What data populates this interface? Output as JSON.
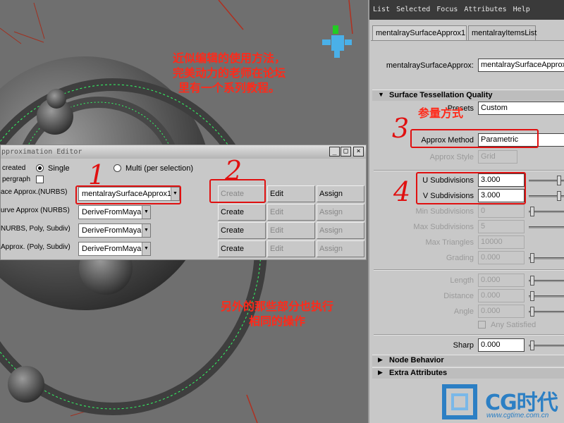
{
  "annotations": {
    "top_note_line1": "近似编辑的使用方法，",
    "top_note_line2": "完美动力的老师在论坛",
    "top_note_line3": "里有一个系列教程。",
    "bottom_note_line1": "另外的那些部分也执行",
    "bottom_note_line2": "相同的操作",
    "approx_method_note": "参量方式",
    "num1": "1",
    "num2": "2",
    "num3": "3",
    "num4": "4"
  },
  "editor": {
    "title": "pproximation Editor",
    "minimize": "_",
    "maximize": "□",
    "close": "×",
    "created_label": "created",
    "single_label": "Single",
    "multi_label": "Multi (per selection)",
    "pergraph_label": "pergraph",
    "rows": [
      {
        "label": "ace Approx.(NURBS)",
        "value": "mentalraySurfaceApprox1",
        "create": "Create",
        "edit": "Edit",
        "assign": "Assign",
        "edit_dim": false,
        "create_dim": true
      },
      {
        "label": "urve Approx (NURBS)",
        "value": "DeriveFromMaya",
        "create": "Create",
        "edit": "Edit",
        "assign": "Assign",
        "edit_dim": true,
        "create_dim": false
      },
      {
        "label": "NURBS, Poly, Subdiv)",
        "value": "DeriveFromMaya",
        "create": "Create",
        "edit": "Edit",
        "assign": "Assign",
        "edit_dim": true,
        "create_dim": false
      },
      {
        "label": "Approx. (Poly, Subdiv)",
        "value": "DeriveFromMaya",
        "create": "Create",
        "edit": "Edit",
        "assign": "Assign",
        "edit_dim": true,
        "create_dim": false
      }
    ]
  },
  "attr": {
    "menu": "List  Selected  Focus  Attributes  Help",
    "tabs": [
      "mentalraySurfaceApprox1",
      "mentalrayItemsList"
    ],
    "node_label": "mentalraySurfaceApprox:",
    "node_value": "mentalraySurfaceApprox1",
    "section_tess": "Surface Tessellation Quality",
    "presets_label": "Presets",
    "presets_value": "Custom",
    "approx_method_label": "Approx Method",
    "approx_method_value": "Parametric",
    "approx_style_label": "Approx Style",
    "approx_style_value": "Grid",
    "u_sub_label": "U Subdivisions",
    "u_sub_value": "3.000",
    "v_sub_label": "V Subdivisions",
    "v_sub_value": "3.000",
    "min_sub_label": "Min Subdivisions",
    "min_sub_value": "0",
    "max_sub_label": "Max Subdivisions",
    "max_sub_value": "5",
    "max_tri_label": "Max Triangles",
    "max_tri_value": "10000",
    "grading_label": "Grading",
    "grading_value": "0.000",
    "length_label": "Length",
    "length_value": "0.000",
    "distance_label": "Distance",
    "distance_value": "0.000",
    "angle_label": "Angle",
    "angle_value": "0.000",
    "any_satisfied_label": "Any Satisfied",
    "sharp_label": "Sharp",
    "sharp_value": "0.000",
    "section_node": "Node Behavior",
    "section_extra": "Extra Attributes"
  },
  "logo": {
    "text": "CG时代",
    "url": "www.cgtime.com.cn"
  },
  "colors": {
    "annotation": "#ff2a1a",
    "wireframe": "#33ff66",
    "logo": "#2c7fc4"
  }
}
